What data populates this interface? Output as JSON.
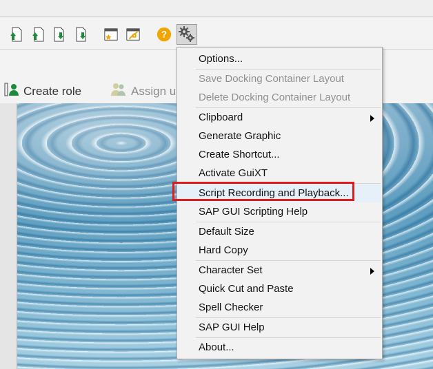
{
  "toolbar": {
    "icons": [
      "upload-doc-icon",
      "upload-doc-alt-icon",
      "download-doc-icon",
      "download-doc-alt-icon",
      "favorites-add-icon",
      "favorites-open-icon",
      "help-icon",
      "settings-gear-icon"
    ]
  },
  "actions": {
    "create_role": "Create role",
    "assign_user": "Assign u"
  },
  "menu": {
    "items": [
      {
        "label": "Options...",
        "disabled": false
      },
      {
        "label": "Save Docking Container Layout",
        "disabled": true
      },
      {
        "label": "Delete Docking Container Layout",
        "disabled": true
      },
      {
        "label": "Clipboard",
        "disabled": false,
        "submenu": true
      },
      {
        "label": "Generate Graphic",
        "disabled": false
      },
      {
        "label": "Create Shortcut...",
        "disabled": false
      },
      {
        "label": "Activate GuiXT",
        "disabled": false
      },
      {
        "label": "Script Recording and Playback...",
        "disabled": false,
        "highlighted": true
      },
      {
        "label": "SAP GUI Scripting Help",
        "disabled": false
      },
      {
        "label": "Default Size",
        "disabled": false
      },
      {
        "label": "Hard Copy",
        "disabled": false
      },
      {
        "label": "Character Set",
        "disabled": false,
        "submenu": true
      },
      {
        "label": "Quick Cut and Paste",
        "disabled": false
      },
      {
        "label": "Spell Checker",
        "disabled": false
      },
      {
        "label": "SAP GUI Help",
        "disabled": false
      },
      {
        "label": "About...",
        "disabled": false
      }
    ]
  },
  "colors": {
    "highlight_border": "#e01b1b",
    "menu_bg": "#f2f2f2",
    "help_orange": "#f0a500",
    "icon_green": "#1e8b3a"
  }
}
